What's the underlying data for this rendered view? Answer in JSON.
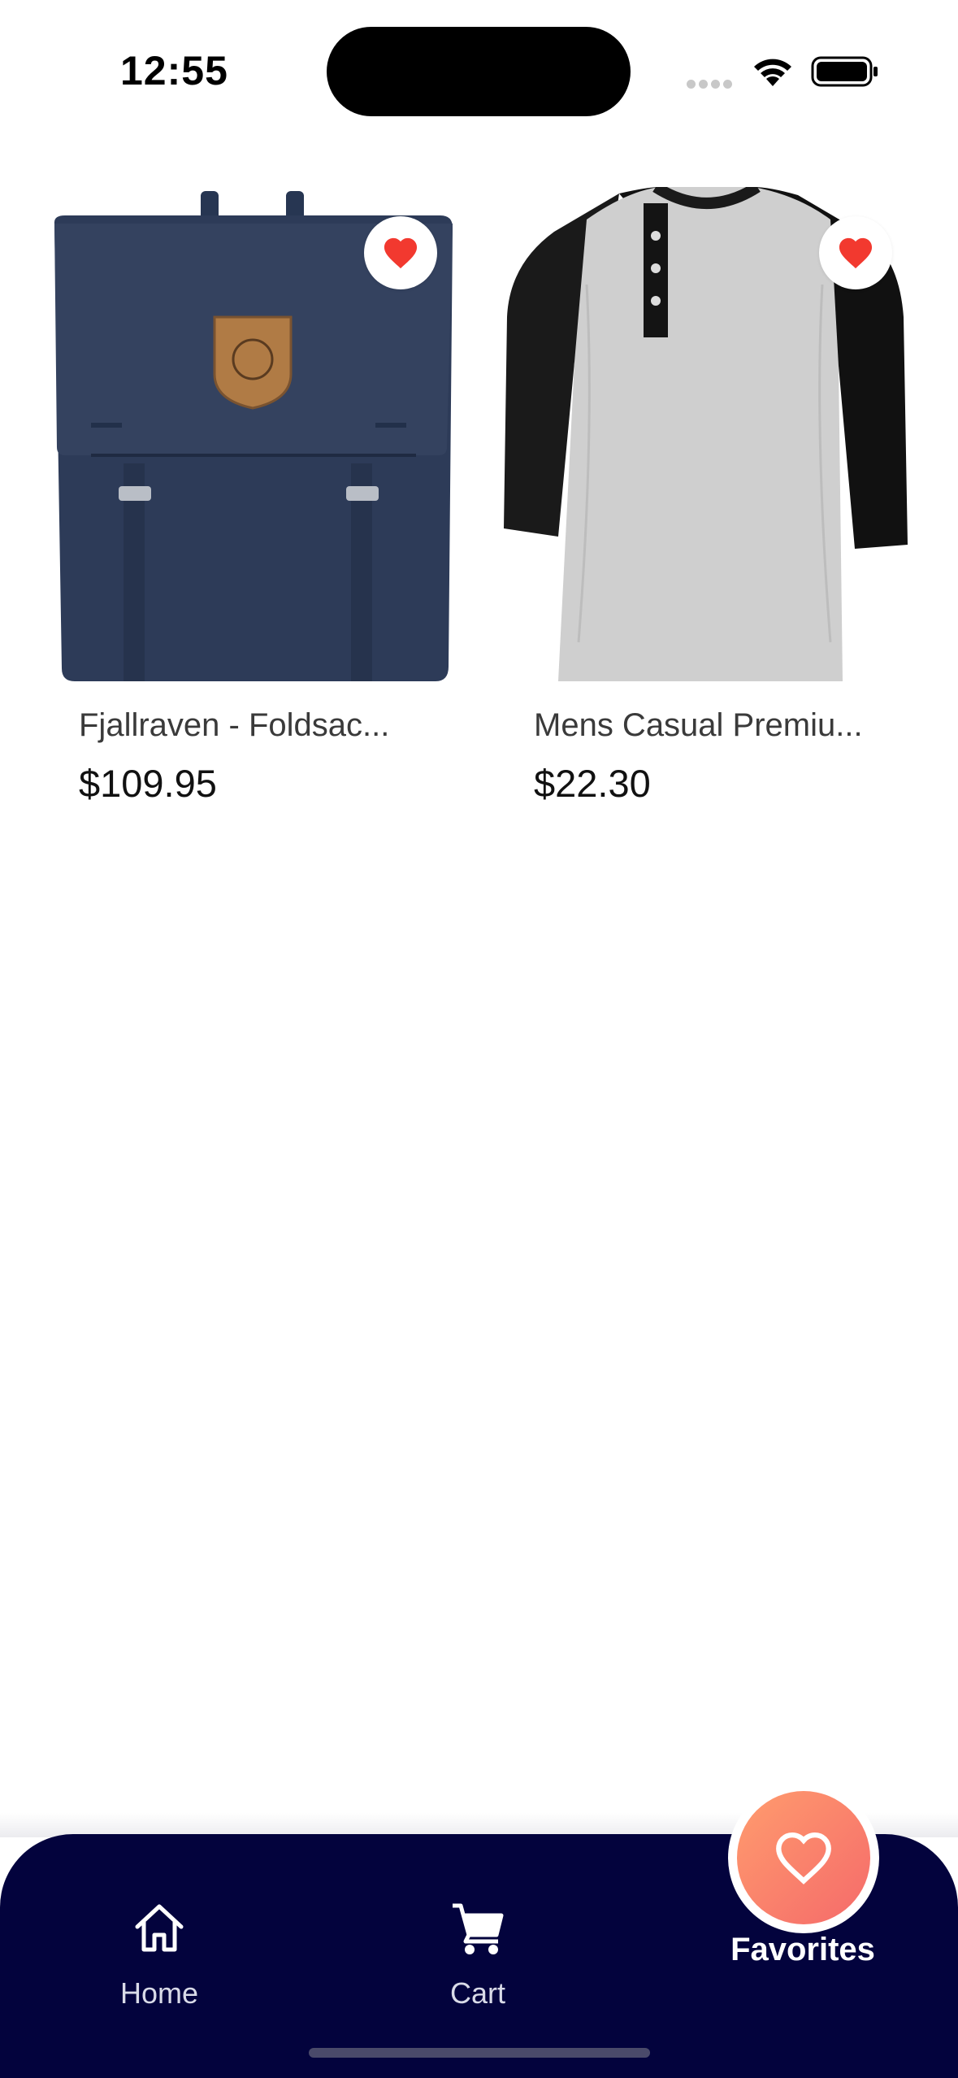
{
  "status_bar": {
    "time": "12:55",
    "icons": [
      "signal-icon",
      "wifi-icon",
      "battery-icon"
    ]
  },
  "products": [
    {
      "title": "Fjallraven - Foldsac...",
      "price": "$109.95",
      "favorited": true,
      "image": "backpack-image"
    },
    {
      "title": "Mens Casual Premiu...",
      "price": "$22.30",
      "favorited": true,
      "image": "shirt-image"
    }
  ],
  "bottom_nav": {
    "items": [
      {
        "label": "Home",
        "icon": "home-icon"
      },
      {
        "label": "Cart",
        "icon": "cart-icon"
      },
      {
        "label": "Favorites",
        "icon": "heart-icon",
        "active": true
      }
    ]
  },
  "colors": {
    "nav_background": "#03033d",
    "favorite_red": "#f2392f",
    "active_gradient_start": "#ff9c6e",
    "active_gradient_end": "#f56a6a"
  }
}
